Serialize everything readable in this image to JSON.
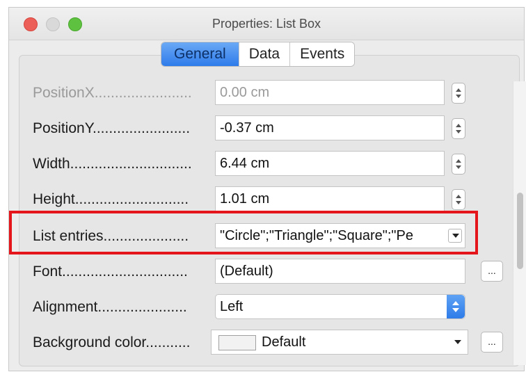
{
  "window": {
    "title": "Properties: List Box"
  },
  "tabs": [
    "General",
    "Data",
    "Events"
  ],
  "fields": {
    "position_x": {
      "label": "PositionX........................",
      "value": "0.00 cm"
    },
    "position_y": {
      "label": "PositionY........................",
      "value": "-0.37 cm"
    },
    "width": {
      "label": "Width..............................",
      "value": "6.44 cm"
    },
    "height": {
      "label": "Height............................",
      "value": "1.01 cm"
    },
    "list_entries": {
      "label": "List entries.....................",
      "value": "\"Circle\";\"Triangle\";\"Square\";\"Pe"
    },
    "font": {
      "label": "Font...............................",
      "value": "(Default)",
      "button": "..."
    },
    "alignment": {
      "label": "Alignment......................",
      "value": "Left"
    },
    "background_color": {
      "label": "Background color...........",
      "value": "Default",
      "button": "..."
    }
  },
  "colors": {
    "accent": "#2e7bea",
    "highlight_box": "#e4161b"
  }
}
